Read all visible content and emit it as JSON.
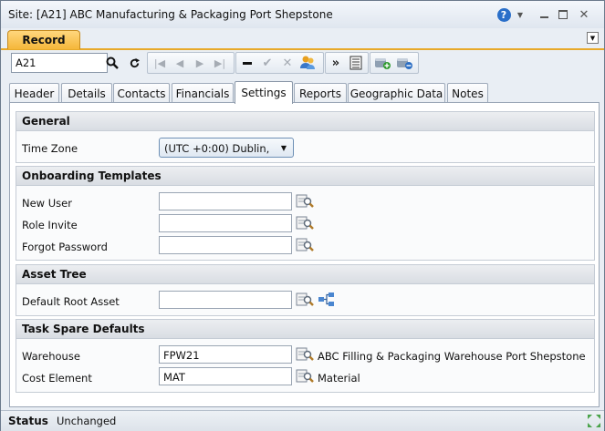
{
  "window": {
    "title": "Site: [A21] ABC Manufacturing & Packaging Port Shepstone"
  },
  "ribbon": {
    "tab_label": "Record"
  },
  "toolbar": {
    "record_value": "A21"
  },
  "tabs": [
    {
      "label": "Header"
    },
    {
      "label": "Details"
    },
    {
      "label": "Contacts"
    },
    {
      "label": "Financials"
    },
    {
      "label": "Settings"
    },
    {
      "label": "Reports"
    },
    {
      "label": "Geographic Data"
    },
    {
      "label": "Notes"
    }
  ],
  "sections": {
    "general": {
      "title": "General",
      "time_zone_label": "Time Zone",
      "time_zone_value": "(UTC +0:00) Dublin,"
    },
    "onboarding": {
      "title": "Onboarding Templates",
      "new_user_label": "New User",
      "role_invite_label": "Role Invite",
      "forgot_password_label": "Forgot Password"
    },
    "asset_tree": {
      "title": "Asset Tree",
      "default_root_label": "Default Root Asset"
    },
    "task_spare": {
      "title": "Task Spare Defaults",
      "warehouse_label": "Warehouse",
      "warehouse_value": "FPW21",
      "warehouse_desc": "ABC Filling & Packaging Warehouse Port Shepstone",
      "cost_element_label": "Cost Element",
      "cost_element_value": "MAT",
      "cost_element_desc": "Material"
    }
  },
  "status": {
    "label": "Status",
    "value": "Unchanged"
  },
  "colors": {
    "accent": "#f5b73a",
    "help": "#2a6fc9"
  }
}
